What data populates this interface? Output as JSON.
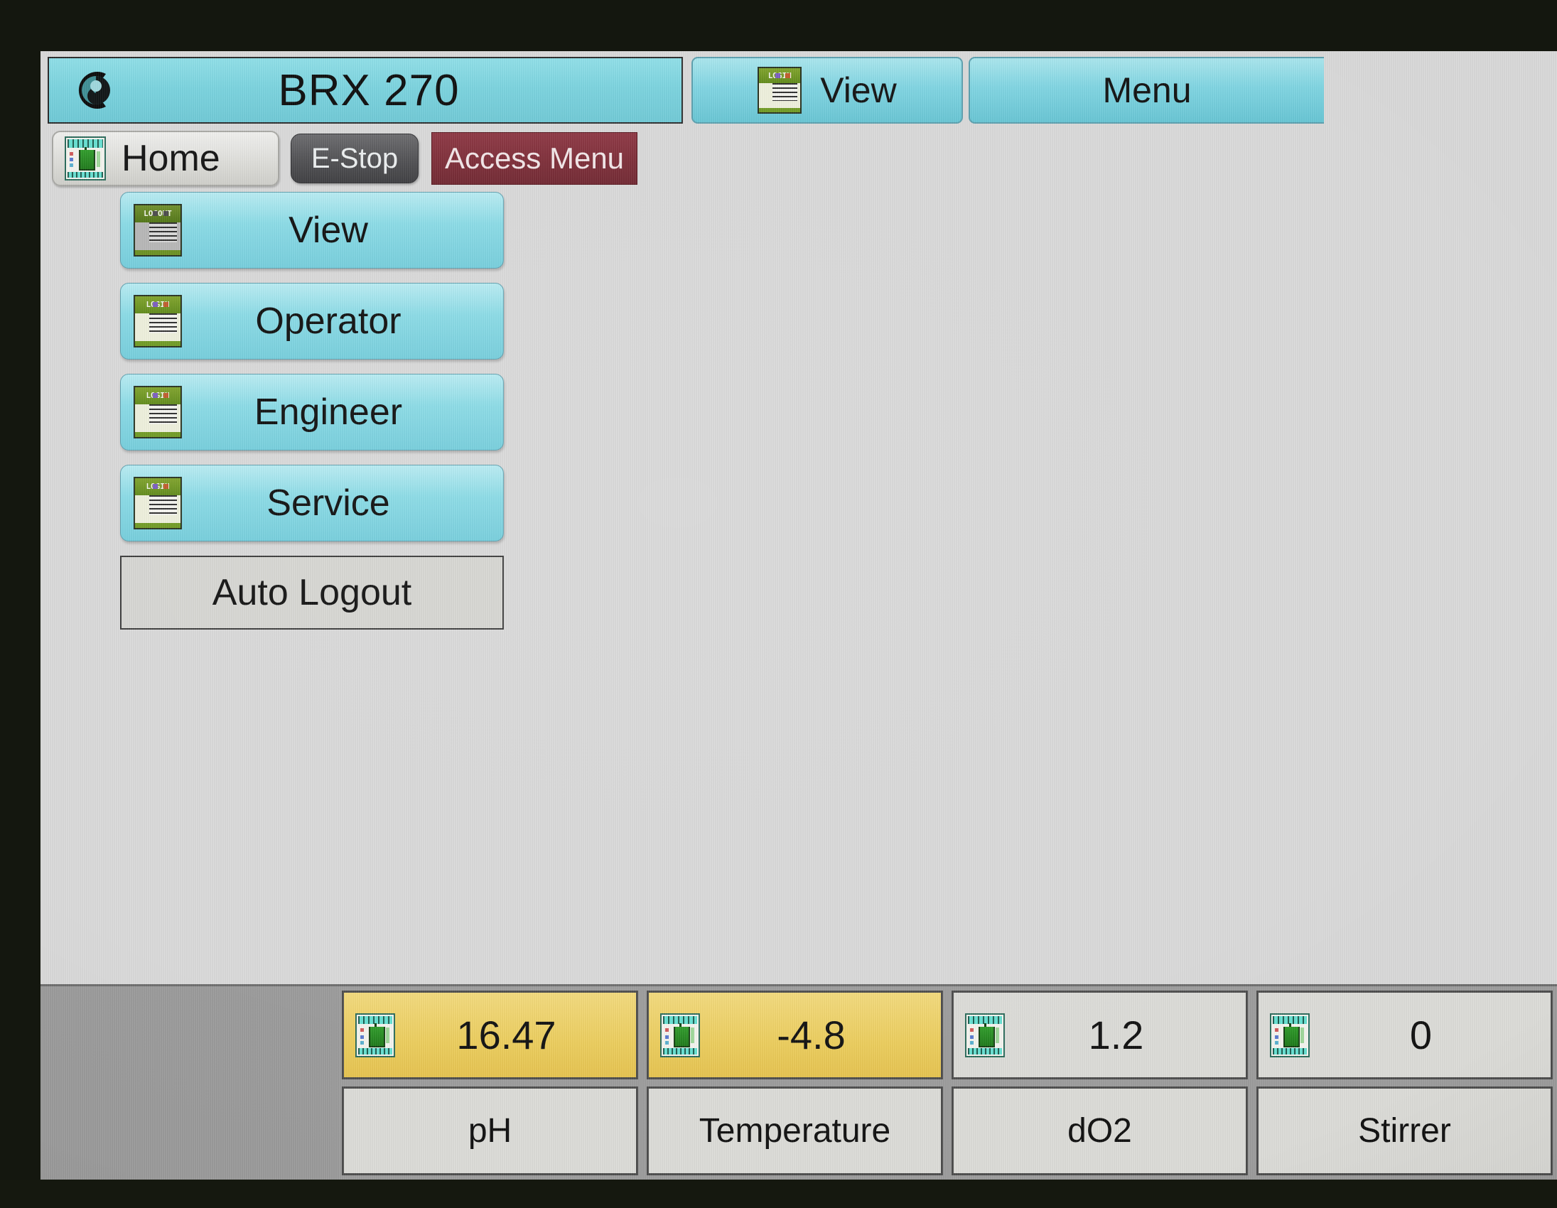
{
  "device": {
    "model": "BRX 270",
    "logo_icon": "swirl-logo-icon"
  },
  "header": {
    "title": "BRX 270",
    "view_button": {
      "label": "View",
      "icon": "login-icon"
    },
    "menu_button": {
      "label": "Menu"
    }
  },
  "toolbar": {
    "home": {
      "label": "Home",
      "icon": "bioreactor-icon"
    },
    "estop": {
      "label": "E-Stop"
    },
    "access_menu": {
      "label": "Access Menu"
    }
  },
  "access_levels": [
    {
      "label": "View",
      "icon": "logout-icon",
      "icon_caption": "LOGOUT",
      "state": "logged-in"
    },
    {
      "label": "Operator",
      "icon": "login-icon",
      "icon_caption": "LOGIN",
      "state": "logged-out"
    },
    {
      "label": "Engineer",
      "icon": "login-icon",
      "icon_caption": "LOGIN",
      "state": "logged-out"
    },
    {
      "label": "Service",
      "icon": "login-icon",
      "icon_caption": "LOGIN",
      "state": "logged-out"
    }
  ],
  "auto_logout": {
    "label": "Auto Logout"
  },
  "status_bar": {
    "channels": [
      {
        "name": "pH",
        "value": "16.47",
        "icon": "bioreactor-icon",
        "alarm": true
      },
      {
        "name": "Temperature",
        "value": "-4.8",
        "icon": "bioreactor-icon",
        "alarm": true
      },
      {
        "name": "dO2",
        "value": "1.2",
        "icon": "bioreactor-icon",
        "alarm": false
      },
      {
        "name": "Stirrer",
        "value": "0",
        "icon": "bioreactor-icon",
        "alarm": false
      }
    ]
  },
  "colors": {
    "header_cyan": "#79d3de",
    "button_cyan": "#89dbe6",
    "estop_gray": "#4e4e51",
    "access_maroon": "#7c2b36",
    "alarm_yellow": "#eccd5c",
    "screen_gray": "#d9d9d9",
    "statusbar_gray": "#9c9c9c"
  }
}
